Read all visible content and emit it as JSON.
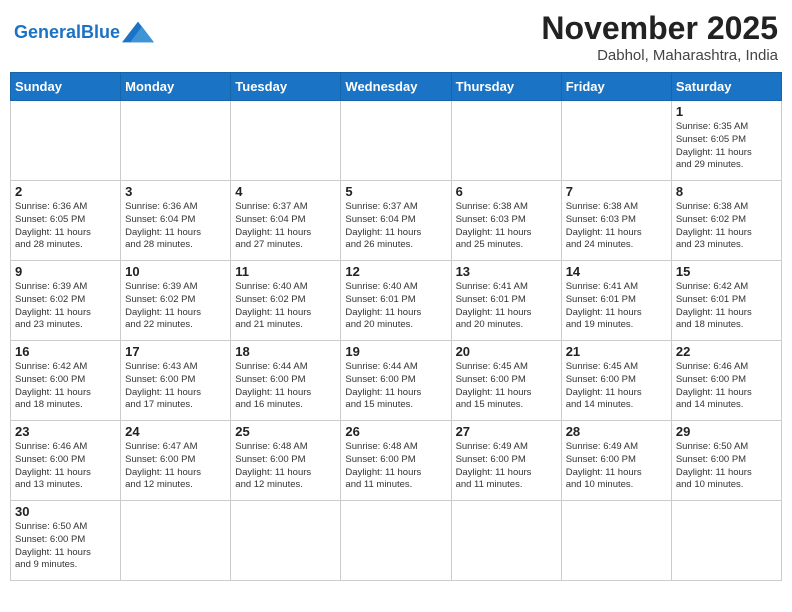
{
  "header": {
    "logo_general": "General",
    "logo_blue": "Blue",
    "month_title": "November 2025",
    "location": "Dabhol, Maharashtra, India"
  },
  "weekdays": [
    "Sunday",
    "Monday",
    "Tuesday",
    "Wednesday",
    "Thursday",
    "Friday",
    "Saturday"
  ],
  "weeks": [
    [
      {
        "day": "",
        "info": ""
      },
      {
        "day": "",
        "info": ""
      },
      {
        "day": "",
        "info": ""
      },
      {
        "day": "",
        "info": ""
      },
      {
        "day": "",
        "info": ""
      },
      {
        "day": "",
        "info": ""
      },
      {
        "day": "1",
        "info": "Sunrise: 6:35 AM\nSunset: 6:05 PM\nDaylight: 11 hours\nand 29 minutes."
      }
    ],
    [
      {
        "day": "2",
        "info": "Sunrise: 6:36 AM\nSunset: 6:05 PM\nDaylight: 11 hours\nand 28 minutes."
      },
      {
        "day": "3",
        "info": "Sunrise: 6:36 AM\nSunset: 6:04 PM\nDaylight: 11 hours\nand 28 minutes."
      },
      {
        "day": "4",
        "info": "Sunrise: 6:37 AM\nSunset: 6:04 PM\nDaylight: 11 hours\nand 27 minutes."
      },
      {
        "day": "5",
        "info": "Sunrise: 6:37 AM\nSunset: 6:04 PM\nDaylight: 11 hours\nand 26 minutes."
      },
      {
        "day": "6",
        "info": "Sunrise: 6:38 AM\nSunset: 6:03 PM\nDaylight: 11 hours\nand 25 minutes."
      },
      {
        "day": "7",
        "info": "Sunrise: 6:38 AM\nSunset: 6:03 PM\nDaylight: 11 hours\nand 24 minutes."
      },
      {
        "day": "8",
        "info": "Sunrise: 6:38 AM\nSunset: 6:02 PM\nDaylight: 11 hours\nand 23 minutes."
      }
    ],
    [
      {
        "day": "9",
        "info": "Sunrise: 6:39 AM\nSunset: 6:02 PM\nDaylight: 11 hours\nand 23 minutes."
      },
      {
        "day": "10",
        "info": "Sunrise: 6:39 AM\nSunset: 6:02 PM\nDaylight: 11 hours\nand 22 minutes."
      },
      {
        "day": "11",
        "info": "Sunrise: 6:40 AM\nSunset: 6:02 PM\nDaylight: 11 hours\nand 21 minutes."
      },
      {
        "day": "12",
        "info": "Sunrise: 6:40 AM\nSunset: 6:01 PM\nDaylight: 11 hours\nand 20 minutes."
      },
      {
        "day": "13",
        "info": "Sunrise: 6:41 AM\nSunset: 6:01 PM\nDaylight: 11 hours\nand 20 minutes."
      },
      {
        "day": "14",
        "info": "Sunrise: 6:41 AM\nSunset: 6:01 PM\nDaylight: 11 hours\nand 19 minutes."
      },
      {
        "day": "15",
        "info": "Sunrise: 6:42 AM\nSunset: 6:01 PM\nDaylight: 11 hours\nand 18 minutes."
      }
    ],
    [
      {
        "day": "16",
        "info": "Sunrise: 6:42 AM\nSunset: 6:00 PM\nDaylight: 11 hours\nand 18 minutes."
      },
      {
        "day": "17",
        "info": "Sunrise: 6:43 AM\nSunset: 6:00 PM\nDaylight: 11 hours\nand 17 minutes."
      },
      {
        "day": "18",
        "info": "Sunrise: 6:44 AM\nSunset: 6:00 PM\nDaylight: 11 hours\nand 16 minutes."
      },
      {
        "day": "19",
        "info": "Sunrise: 6:44 AM\nSunset: 6:00 PM\nDaylight: 11 hours\nand 15 minutes."
      },
      {
        "day": "20",
        "info": "Sunrise: 6:45 AM\nSunset: 6:00 PM\nDaylight: 11 hours\nand 15 minutes."
      },
      {
        "day": "21",
        "info": "Sunrise: 6:45 AM\nSunset: 6:00 PM\nDaylight: 11 hours\nand 14 minutes."
      },
      {
        "day": "22",
        "info": "Sunrise: 6:46 AM\nSunset: 6:00 PM\nDaylight: 11 hours\nand 14 minutes."
      }
    ],
    [
      {
        "day": "23",
        "info": "Sunrise: 6:46 AM\nSunset: 6:00 PM\nDaylight: 11 hours\nand 13 minutes."
      },
      {
        "day": "24",
        "info": "Sunrise: 6:47 AM\nSunset: 6:00 PM\nDaylight: 11 hours\nand 12 minutes."
      },
      {
        "day": "25",
        "info": "Sunrise: 6:48 AM\nSunset: 6:00 PM\nDaylight: 11 hours\nand 12 minutes."
      },
      {
        "day": "26",
        "info": "Sunrise: 6:48 AM\nSunset: 6:00 PM\nDaylight: 11 hours\nand 11 minutes."
      },
      {
        "day": "27",
        "info": "Sunrise: 6:49 AM\nSunset: 6:00 PM\nDaylight: 11 hours\nand 11 minutes."
      },
      {
        "day": "28",
        "info": "Sunrise: 6:49 AM\nSunset: 6:00 PM\nDaylight: 11 hours\nand 10 minutes."
      },
      {
        "day": "29",
        "info": "Sunrise: 6:50 AM\nSunset: 6:00 PM\nDaylight: 11 hours\nand 10 minutes."
      }
    ],
    [
      {
        "day": "30",
        "info": "Sunrise: 6:50 AM\nSunset: 6:00 PM\nDaylight: 11 hours\nand 9 minutes."
      },
      {
        "day": "",
        "info": ""
      },
      {
        "day": "",
        "info": ""
      },
      {
        "day": "",
        "info": ""
      },
      {
        "day": "",
        "info": ""
      },
      {
        "day": "",
        "info": ""
      },
      {
        "day": "",
        "info": ""
      }
    ]
  ]
}
